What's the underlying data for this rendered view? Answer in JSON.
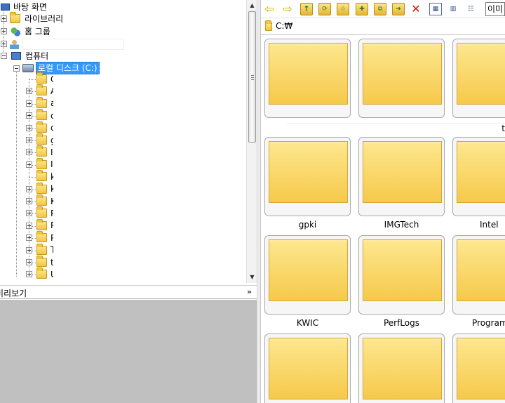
{
  "tree": {
    "desktop": "바탕 화면",
    "libraries": "라이브러리",
    "homegroup": "홈 그룹",
    "computer": "컴퓨터",
    "local_disk": "로컬 디스크 (C:)",
    "children_initials": [
      "C",
      "A",
      "a",
      "c",
      "c",
      "g",
      "I",
      "I",
      "k",
      "k",
      "K",
      "P",
      "P",
      "P",
      "T",
      "t",
      "U"
    ]
  },
  "preview": {
    "title": "미리보기",
    "toggle": "»"
  },
  "toolbar": {
    "view_mode": "이미"
  },
  "address": {
    "path": "C:₩"
  },
  "thumbnails": {
    "row1_fragment": "t",
    "row2": [
      "gpki",
      "IMGTech",
      "Intel"
    ],
    "row3": [
      "KWIC",
      "PerfLogs",
      "Program"
    ]
  }
}
